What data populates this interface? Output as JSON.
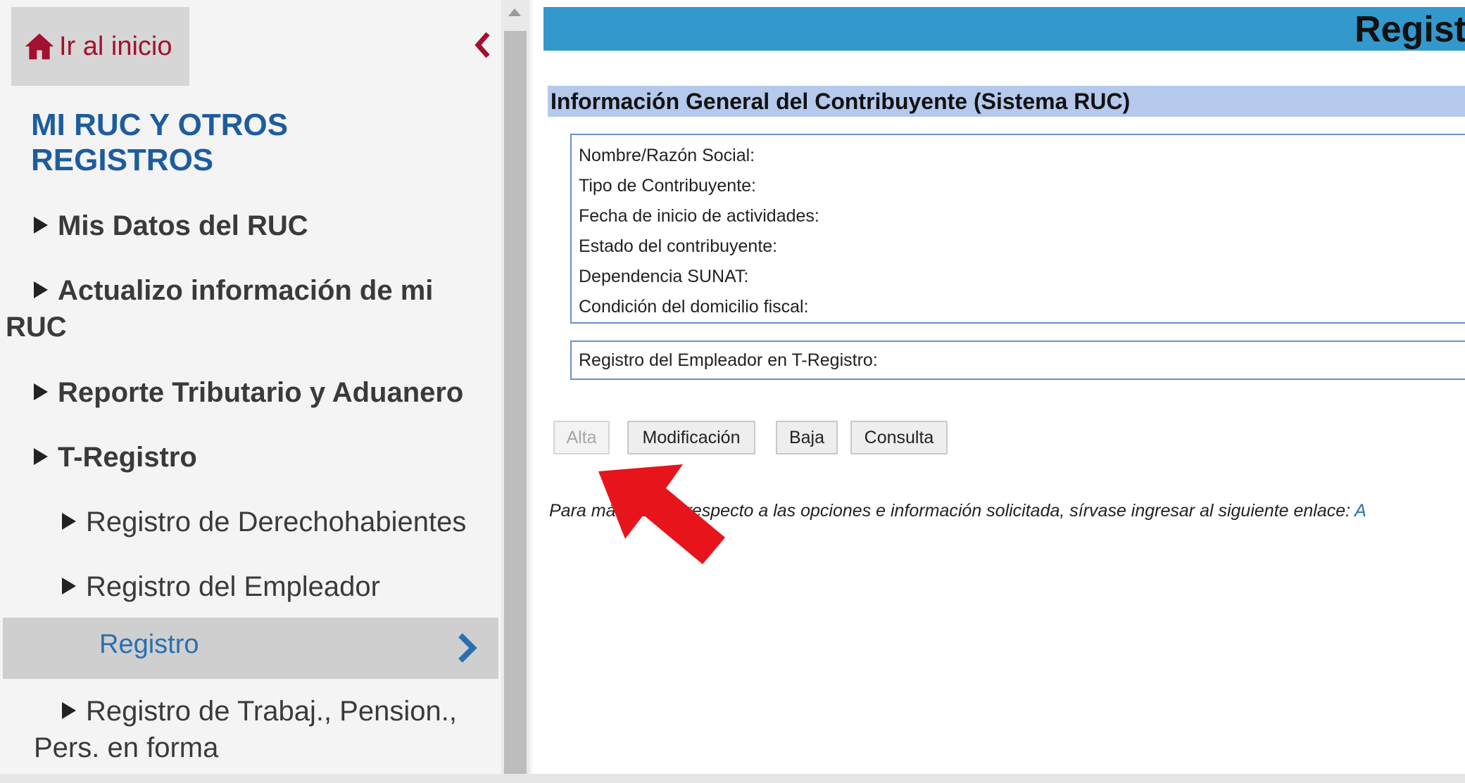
{
  "sidebar": {
    "home_label": "Ir al inicio",
    "section_title": "MI RUC Y OTROS REGISTROS",
    "items": [
      {
        "label": "Mis Datos del RUC"
      },
      {
        "label_line1": "Actualizo información de mi",
        "label_line2": "RUC"
      },
      {
        "label": "Reporte Tributario y Aduanero"
      },
      {
        "label": "T-Registro"
      },
      {
        "label": "Registro de Derechohabientes"
      },
      {
        "label": "Registro del Empleador"
      },
      {
        "label": "Registro",
        "active": true
      },
      {
        "label_line1": "Registro de Trabaj., Pension.,",
        "label_line2": "Pers. en forma"
      }
    ]
  },
  "main": {
    "top_title": "Regist",
    "info_header": "Información General del Contribuyente (Sistema RUC)",
    "info_fields": [
      "Nombre/Razón Social:",
      "Tipo de Contribuyente:",
      "Fecha de inicio de actividades:",
      "Estado del contribuyente:",
      "Dependencia SUNAT:",
      "Condición del domicilio fiscal:"
    ],
    "employer_field": "Registro del Empleador en T-Registro:",
    "buttons": {
      "alta": "Alta",
      "modificacion": "Modificación",
      "baja": "Baja",
      "consulta": "Consulta"
    },
    "help_text": "Para más detalle respecto a las opciones e información solicitada, sírvase ingresar al siguiente enlace:",
    "help_link": "A"
  },
  "colors": {
    "accent_red": "#a4102f",
    "title_blue": "#1d5c9e",
    "top_bar": "#3399cc",
    "header_bar": "#b4c9ec",
    "arrow_red": "#e8141c"
  },
  "icons": {
    "home": "home-icon",
    "collapse": "chevron-left-icon",
    "active": "chevron-right-icon",
    "annotation": "red-arrow-icon"
  }
}
